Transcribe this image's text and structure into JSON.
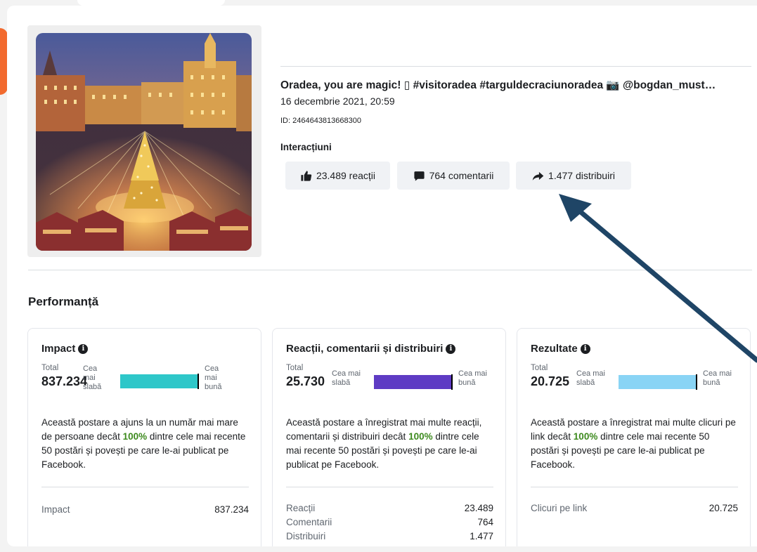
{
  "post": {
    "title": "Oradea, you are magic! ▯ #visitoradea #targuldecraciunoradea 📷 @bogdan_must…",
    "date": "16 decembrie 2021, 20:59",
    "id": "ID: 2464643813668300",
    "interactions_label": "Interacțiuni",
    "reactions": "23.489 reacții",
    "comments": "764 comentarii",
    "shares": "1.477 distribuiri"
  },
  "icons": {
    "reactions": "thumbs-up-icon",
    "comments": "speech-bubble-icon",
    "shares": "share-arrow-icon",
    "info": "info-icon",
    "annotation": "annotation-arrow"
  },
  "performance": {
    "title": "Performanță",
    "cards": [
      {
        "title": "Impact",
        "total_label": "Total",
        "total": "837.234",
        "weak_label": "Cea mai slabă",
        "weak_lines": [
          "Cea",
          "mai",
          "slabă"
        ],
        "best_label": "Cea mai bună",
        "best_lines": [
          "Cea",
          "mai",
          "bună"
        ],
        "bar_fraction": 1.0,
        "bar_color": "#2ec7c9",
        "desc_before": "Această postare a ajuns la un număr mai mare de persoane decât ",
        "desc_pct": "100%",
        "desc_after": " dintre cele mai recente 50 postări și povești pe care le-ai publicat pe Facebook.",
        "rows": [
          {
            "label": "Impact",
            "value": "837.234"
          }
        ]
      },
      {
        "title": "Reacții, comentarii și distribuiri",
        "total_label": "Total",
        "total": "25.730",
        "weak_label": "Cea mai slabă",
        "weak_lines": [
          "Cea mai",
          "slabă"
        ],
        "best_label": "Cea mai bună",
        "best_lines": [
          "Cea mai",
          "bună"
        ],
        "bar_fraction": 1.0,
        "bar_color": "#5e3bc4",
        "desc_before": "Această postare a înregistrat mai multe reacții, comentarii și distribuiri decât ",
        "desc_pct": "100%",
        "desc_after": " dintre cele mai recente 50 postări și povești pe care le-ai publicat pe Facebook.",
        "rows": [
          {
            "label": "Reacții",
            "value": "23.489"
          },
          {
            "label": "Comentarii",
            "value": "764"
          },
          {
            "label": "Distribuiri",
            "value": "1.477"
          }
        ]
      },
      {
        "title": "Rezultate",
        "total_label": "Total",
        "total": "20.725",
        "weak_label": "Cea mai slabă",
        "weak_lines": [
          "Cea mai",
          "slabă"
        ],
        "best_label": "Cea mai bună",
        "best_lines": [
          "Cea mai",
          "bună"
        ],
        "bar_fraction": 1.0,
        "bar_color": "#89d4f5",
        "desc_before": "Această postare a înregistrat mai multe clicuri pe link decât ",
        "desc_pct": "100%",
        "desc_after": " dintre cele mai recente 50 postări și povești pe care le-ai publicat pe Facebook.",
        "rows": [
          {
            "label": "Clicuri pe link",
            "value": "20.725"
          }
        ]
      }
    ]
  },
  "colors": {
    "accent_green": "#3d8a1e",
    "annotation_arrow": "#1f4566",
    "pill_bg": "#f0f2f5",
    "edge_orange": "#f26a2e"
  }
}
